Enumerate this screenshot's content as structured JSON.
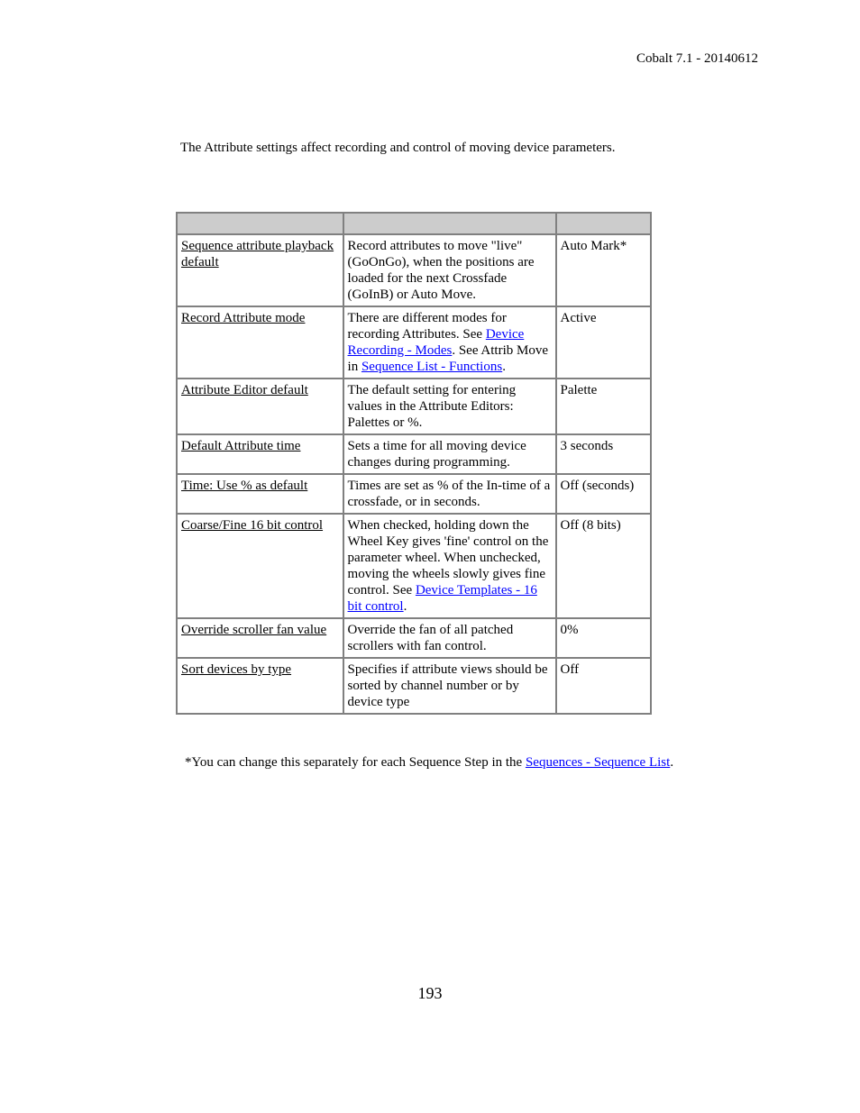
{
  "header": {
    "running_title": "Cobalt 7.1 - 20140612"
  },
  "intro": {
    "text": "The Attribute settings affect recording and control of moving device parameters."
  },
  "table": {
    "columns": [
      "",
      "",
      ""
    ],
    "rows": [
      {
        "setting": "Sequence attribute playback default",
        "description": [
          {
            "text": "Record attributes to move \"live\" (GoOnGo), when the positions are loaded for the next Crossfade (GoInB) or Auto Move."
          }
        ],
        "default": "Auto Mark*"
      },
      {
        "setting": "Record Attribute mode",
        "description": [
          {
            "text": "There are different modes for recording Attributes. See "
          },
          {
            "text": "Device Recording - Modes",
            "link": true
          },
          {
            "text": ". See Attrib Move in "
          },
          {
            "text": "Sequence List - Functions",
            "link": true
          },
          {
            "text": "."
          }
        ],
        "default": "Active"
      },
      {
        "setting": "Attribute Editor default",
        "description": [
          {
            "text": "The default setting for entering values in the Attribute Editors: Palettes or %."
          }
        ],
        "default": "Palette"
      },
      {
        "setting": "Default Attribute time",
        "description": [
          {
            "text": "Sets a time for all moving device changes during programming."
          }
        ],
        "default": "3 seconds"
      },
      {
        "setting": "Time: Use % as default",
        "description": [
          {
            "text": "Times are set as % of the In-time of a crossfade, or in seconds."
          }
        ],
        "default": "Off (seconds)"
      },
      {
        "setting": "Coarse/Fine 16 bit control",
        "description": [
          {
            "text": "When checked, holding down the Wheel Key gives 'fine' control on the parameter wheel. When unchecked, moving the wheels slowly gives fine control. See "
          },
          {
            "text": "Device Templates - 16 bit control",
            "link": true
          },
          {
            "text": "."
          }
        ],
        "default": "Off (8 bits)"
      },
      {
        "setting": "Override scroller fan value",
        "description": [
          {
            "text": "Override the fan of all patched scrollers with fan control."
          }
        ],
        "default": "0%"
      },
      {
        "setting": "Sort devices by type",
        "description": [
          {
            "text": "Specifies if attribute views should be sorted by channel number or by device type"
          }
        ],
        "default": "Off"
      }
    ]
  },
  "footnote": {
    "prefix": "*You can change this separately for each Sequence Step in the ",
    "link": "Sequences - Sequence List",
    "suffix": "."
  },
  "page_number": "193",
  "colors": {
    "link": "#0000ff",
    "table_border": "#808080",
    "header_fill": "#cccccc"
  }
}
